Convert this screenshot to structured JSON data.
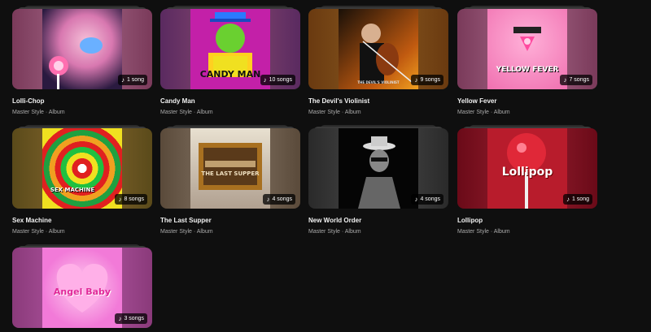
{
  "albums": [
    {
      "title": "Lolli-Chop",
      "meta": "Master Style · Album",
      "count": "1 song",
      "colors": {
        "bg": "#8a3a6a",
        "art": "#e28ac0"
      }
    },
    {
      "title": "Candy Man",
      "meta": "Master Style · Album",
      "count": "10 songs",
      "colors": {
        "bg": "#6a2a70",
        "art": "#c320a8"
      }
    },
    {
      "title": "The Devil's Violinist",
      "meta": "Master Style · Album",
      "count": "9 songs",
      "colors": {
        "bg": "#7a4a1a",
        "art": "#2a1a10"
      }
    },
    {
      "title": "Yellow Fever",
      "meta": "Master Style · Album",
      "count": "7 songs",
      "colors": {
        "bg": "#8a4a6a",
        "art": "#f07ab8"
      }
    },
    {
      "title": "Sex Machine",
      "meta": "Master Style · Album",
      "count": "8 songs",
      "colors": {
        "bg": "#6a5a20",
        "art": "#d0a020"
      }
    },
    {
      "title": "The Last Supper",
      "meta": "Master Style · Album",
      "count": "4 songs",
      "colors": {
        "bg": "#6a5a4a",
        "art": "#c8b8a0"
      }
    },
    {
      "title": "New World Order",
      "meta": "Master Style · Album",
      "count": "4 songs",
      "colors": {
        "bg": "#3a3a3a",
        "art": "#0a0a0a"
      }
    },
    {
      "title": "Lollipop",
      "meta": "Master Style · Album",
      "count": "1 song",
      "colors": {
        "bg": "#7a1020",
        "art": "#b81c2c"
      }
    },
    {
      "title": "Angel Baby",
      "meta": "Master Style · Album",
      "count": "3 songs",
      "colors": {
        "bg": "#9a3a8a",
        "art": "#f27ad8"
      }
    }
  ],
  "art_text": {
    "candy_man": "CANDY MAN",
    "yellow_fever": "YELLOW FEVER",
    "last_supper": "THE LAST SUPPER",
    "lollipop": "Lollipop",
    "angel_baby": "Angel Baby",
    "sex_machine": "SEX MACHINE",
    "devil": "THE DEVIL'S VIOLINIST"
  },
  "icons": {
    "badge": "music-note-icon"
  }
}
